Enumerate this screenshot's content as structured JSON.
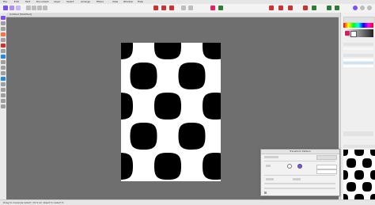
{
  "menubar": {
    "items": [
      "File",
      "Edit",
      "Text",
      "Document",
      "Layer",
      "Select",
      "Arrange",
      "Filters",
      "View",
      "Window",
      "Help"
    ]
  },
  "document": {
    "tab_title": "Untitled [Modified]"
  },
  "statusbar": {
    "text": "Drag to marquee select. Click an object to select it."
  },
  "dialog": {
    "title": "Transform Pattern"
  },
  "colors": {
    "accent": "#7c4dff",
    "canvas_bg": "#6f6f6f",
    "panel_bg": "#efefef"
  }
}
